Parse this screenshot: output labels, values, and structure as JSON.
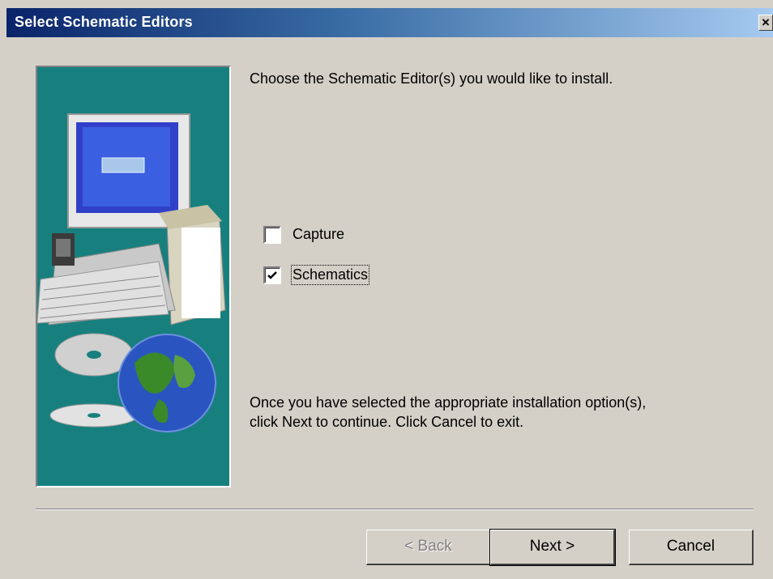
{
  "window": {
    "title": "Select Schematic Editors",
    "close_glyph": "✕"
  },
  "content": {
    "intro": "Choose the Schematic Editor(s) you would like to install.",
    "options": [
      {
        "label": "Capture",
        "checked": false
      },
      {
        "label": "Schematics",
        "checked": true
      }
    ],
    "outro_line1": "Once you have selected the appropriate installation option(s),",
    "outro_line2": "click Next to continue. Click Cancel to exit."
  },
  "buttons": {
    "back": "< Back",
    "next": "Next >",
    "cancel": "Cancel"
  },
  "illustration": {
    "description_icon": "computer-with-globe-and-cds-icon",
    "background_color": "#17807f"
  }
}
